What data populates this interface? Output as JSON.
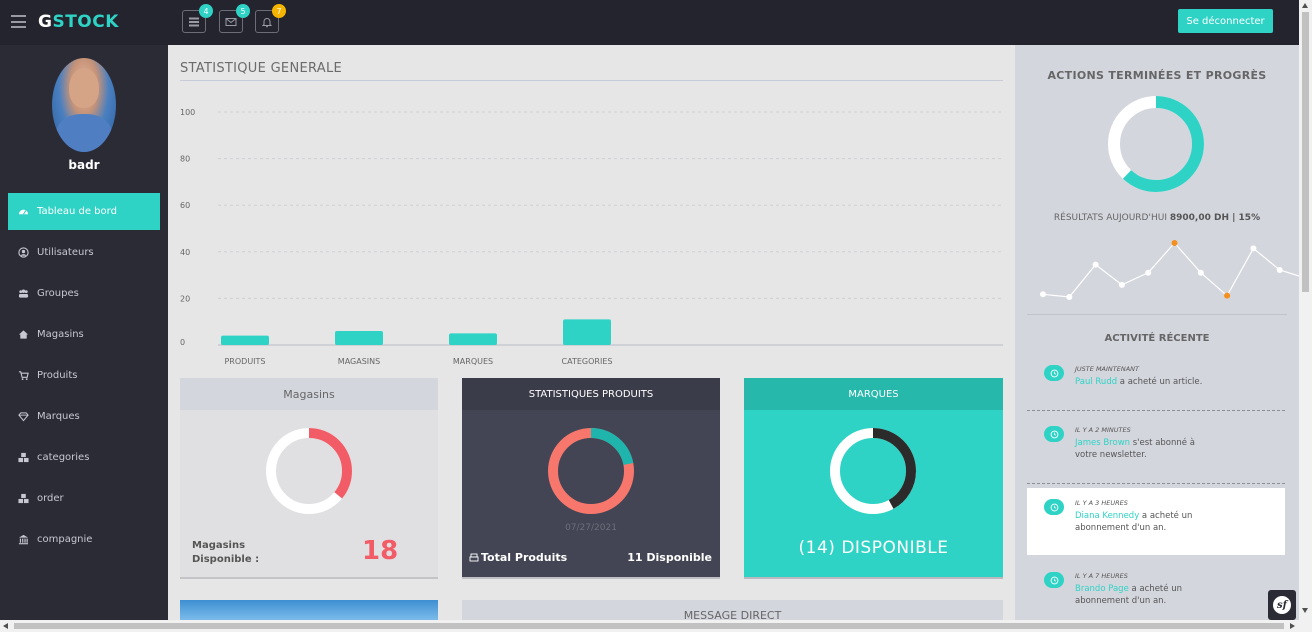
{
  "app": {
    "logo_first": "G",
    "logo_rest": "STOCK"
  },
  "topbar": {
    "icons": [
      {
        "name": "list-icon",
        "count": "4",
        "color": "#2ed3c5"
      },
      {
        "name": "mail-icon",
        "count": "5",
        "color": "#2ed3c5"
      },
      {
        "name": "bell-icon",
        "count": "7",
        "color": "#f5b400"
      }
    ],
    "logout_label": "Se déconnecter"
  },
  "sidebar": {
    "username": "badr",
    "items": [
      {
        "label": "Tableau de bord",
        "icon": "dashboard-icon",
        "active": true
      },
      {
        "label": "Utilisateurs",
        "icon": "user-icon"
      },
      {
        "label": "Groupes",
        "icon": "group-icon"
      },
      {
        "label": "Magasins",
        "icon": "home-icon"
      },
      {
        "label": "Produits",
        "icon": "cart-icon"
      },
      {
        "label": "Marques",
        "icon": "diamond-icon"
      },
      {
        "label": "categories",
        "icon": "cubes-icon"
      },
      {
        "label": "order",
        "icon": "cubes-icon"
      },
      {
        "label": "compagnie",
        "icon": "bank-icon"
      }
    ]
  },
  "main": {
    "stat_title": "STATISTIQUE GENERALE",
    "cards": {
      "magasins": {
        "title": "Magasins",
        "label_line1": "Magasins",
        "label_line2": "Disponible :",
        "value": "18"
      },
      "produits": {
        "title": "STATISTIQUES PRODUITS",
        "date": "07/27/2021",
        "total_label": "Total Produits",
        "available": "11 Disponible"
      },
      "marques": {
        "title": "MARQUES",
        "available": "(14) DISPONIBLE"
      }
    },
    "bottom_message_title": "MESSAGE DIRECT"
  },
  "chart_data": {
    "type": "bar",
    "categories": [
      "PRODUITS",
      "MAGASINS",
      "MARQUES",
      "CATEGORIES"
    ],
    "values": [
      4,
      6,
      5,
      11
    ],
    "yticks": [
      0,
      20,
      40,
      60,
      80,
      100
    ],
    "ylim": [
      0,
      100
    ],
    "grid": true,
    "color": "#2ed3c5"
  },
  "donuts": {
    "magasins": {
      "fraction": 0.36,
      "color": "#f25c66",
      "track": "#ffffff"
    },
    "produits": {
      "fraction": 0.22,
      "color": "#1fb5ad",
      "track": "#f7776c"
    },
    "marques": {
      "fraction": 0.42,
      "color": "#2b2b2b",
      "track": "#ffffff"
    },
    "progress": {
      "fraction": 0.62,
      "color": "#2ed3c5",
      "track": "#ffffff"
    }
  },
  "right_panel": {
    "title": "ACTIONS TERMINÉES ET PROGRÈS",
    "result_label": "RÉSULTATS AUJOURD'HUI",
    "result_value": "8900,00 DH | 15%",
    "sparkline": [
      6,
      4,
      28,
      13,
      22,
      44,
      22,
      5,
      40,
      24,
      18
    ],
    "highlight_points": [
      5,
      7
    ],
    "recent_title": "ACTIVITÉ RÉCENTE",
    "activities": [
      {
        "when": "JUSTE MAINTENANT",
        "who": "Paul Rudd",
        "text": " a acheté un article."
      },
      {
        "when": "IL Y A 2 MINUTES",
        "who": "James Brown",
        "text": " s'est abonné à votre newsletter."
      },
      {
        "when": "IL Y A 3 HEURES",
        "who": "Diana Kennedy",
        "text": " a acheté un abonnement d'un an."
      },
      {
        "when": "IL Y A 7 HEURES",
        "who": "Brando Page",
        "text": " a acheté un abonnement d'un an."
      }
    ]
  }
}
